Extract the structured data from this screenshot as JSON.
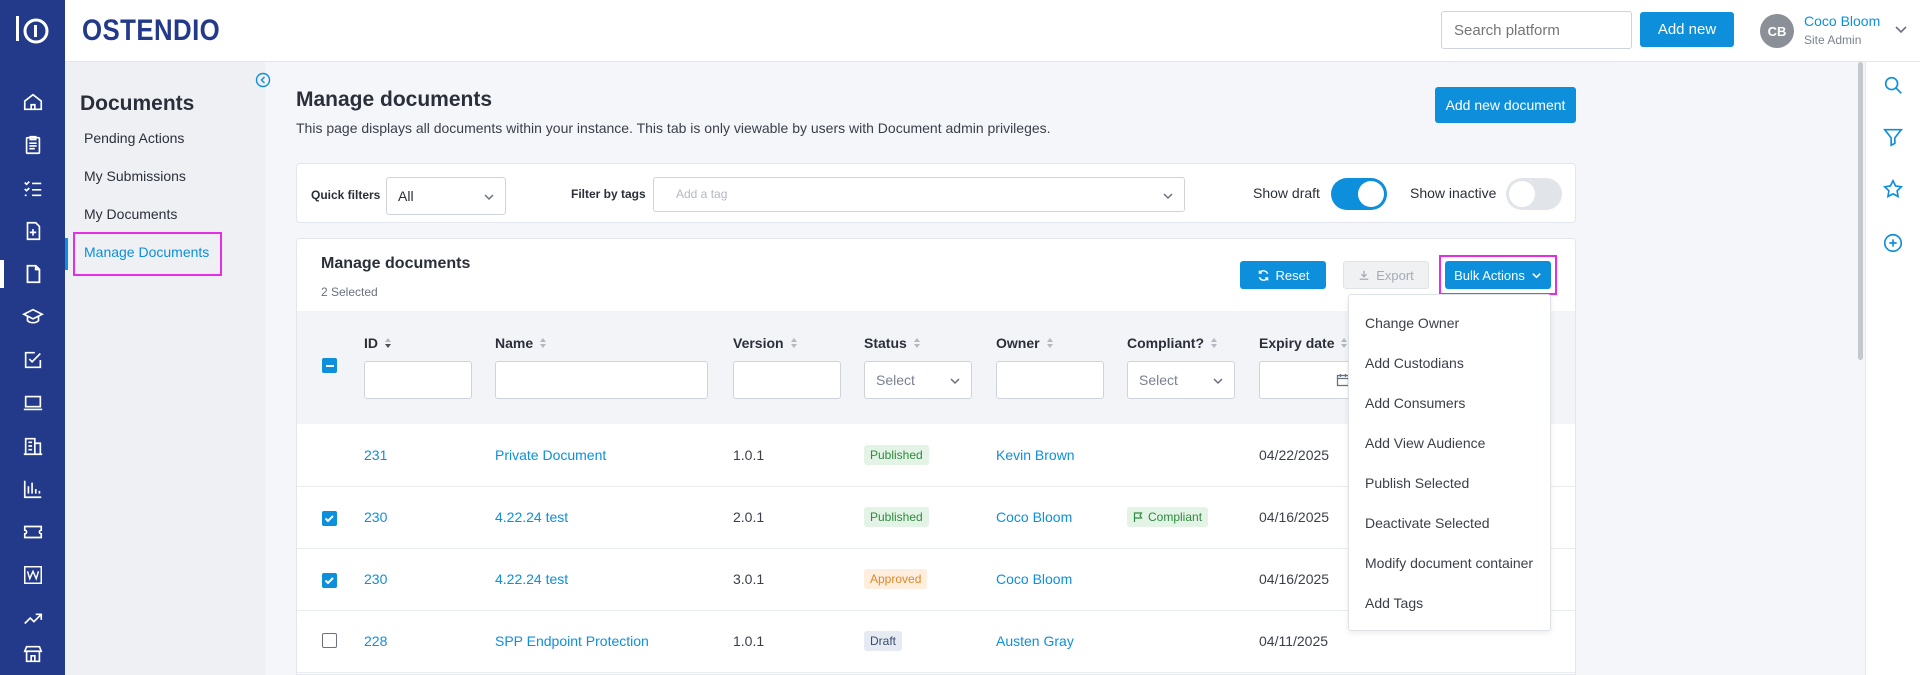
{
  "app": {
    "brand": "OSTENDIO"
  },
  "header": {
    "search_placeholder": "Search platform",
    "add_new_label": "Add new",
    "user": {
      "initials": "CB",
      "name": "Coco Bloom",
      "role": "Site Admin"
    }
  },
  "rail": {
    "items": [
      "home-icon",
      "clipboard-icon",
      "checklist-icon",
      "add-document-icon",
      "document-icon",
      "graduation-cap-icon",
      "check-square-icon",
      "laptop-icon",
      "building-icon",
      "bar-chart-icon",
      "ticket-icon",
      "wiki-icon",
      "trending-up-icon",
      "store-icon"
    ],
    "active": "document-icon"
  },
  "sidebar": {
    "title": "Documents",
    "items": [
      {
        "label": "Pending Actions"
      },
      {
        "label": "My Submissions"
      },
      {
        "label": "My Documents"
      },
      {
        "label": "Manage Documents",
        "active": true
      }
    ]
  },
  "page": {
    "title": "Manage documents",
    "description": "This page displays all documents within your instance. This tab is only viewable by users with Document admin privileges.",
    "add_document_label": "Add new document"
  },
  "filters": {
    "quick_filters_label": "Quick filters",
    "quick_filters_value": "All",
    "tags_label": "Filter by tags",
    "tags_placeholder": "Add a tag",
    "show_draft_label": "Show draft",
    "show_draft_on": true,
    "show_inactive_label": "Show inactive",
    "show_inactive_on": false
  },
  "table_card": {
    "title": "Manage documents",
    "selected_text": "2 Selected",
    "reset_label": "Reset",
    "export_label": "Export",
    "bulk_label": "Bulk Actions",
    "columns": [
      "ID",
      "Name",
      "Version",
      "Status",
      "Owner",
      "Compliant?",
      "Expiry date"
    ],
    "status_filter_placeholder": "Select",
    "compliant_filter_placeholder": "Select",
    "rows": [
      {
        "checked": null,
        "id": "231",
        "name": "Private Document",
        "version": "1.0.1",
        "status": "Published",
        "owner": "Kevin Brown",
        "compliant": "",
        "expiry": "04/22/2025"
      },
      {
        "checked": true,
        "id": "230",
        "name": "4.22.24 test",
        "version": "2.0.1",
        "status": "Published",
        "owner": "Coco Bloom",
        "compliant": "Compliant",
        "expiry": "04/16/2025"
      },
      {
        "checked": true,
        "id": "230",
        "name": "4.22.24 test",
        "version": "3.0.1",
        "status": "Approved",
        "owner": "Coco Bloom",
        "compliant": "",
        "expiry": "04/16/2025"
      },
      {
        "checked": false,
        "id": "228",
        "name": "SPP Endpoint Protection",
        "version": "1.0.1",
        "status": "Draft",
        "owner": "Austen Gray",
        "compliant": "",
        "expiry": "04/11/2025"
      }
    ]
  },
  "bulk_menu": {
    "items": [
      "Change Owner",
      "Add Custodians",
      "Add Consumers",
      "Add View Audience",
      "Publish Selected",
      "Deactivate Selected",
      "Modify document container",
      "Add Tags"
    ]
  },
  "right_panel": {
    "items": [
      "search-icon",
      "filter-icon",
      "star-icon",
      "plus-circle-icon"
    ]
  },
  "colors": {
    "rail": "#233a8b",
    "accent": "#0d8fdb",
    "highlight": "#e52ee5"
  }
}
